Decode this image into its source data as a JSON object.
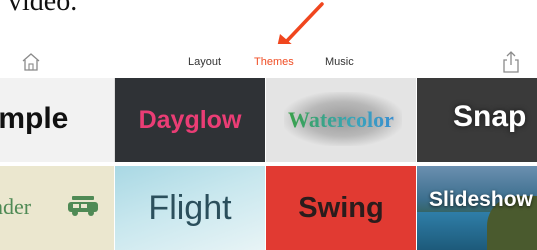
{
  "caption": "video.",
  "tabs": [
    {
      "label": "Layout",
      "active": false
    },
    {
      "label": "Themes",
      "active": true
    },
    {
      "label": "Music",
      "active": false
    }
  ],
  "themes": {
    "simple": "imple",
    "dayglow": "Dayglow",
    "watercolor": "Watercolor",
    "snap": "Snap",
    "wander": "nder",
    "flight": "Flight",
    "swing": "Swing",
    "slideshow": "Slideshow"
  },
  "colors": {
    "accent": "#f04d24",
    "arrow": "#f0461e"
  },
  "icons": {
    "home": "home-icon",
    "share": "share-icon",
    "annotation": "red-arrow-icon"
  }
}
